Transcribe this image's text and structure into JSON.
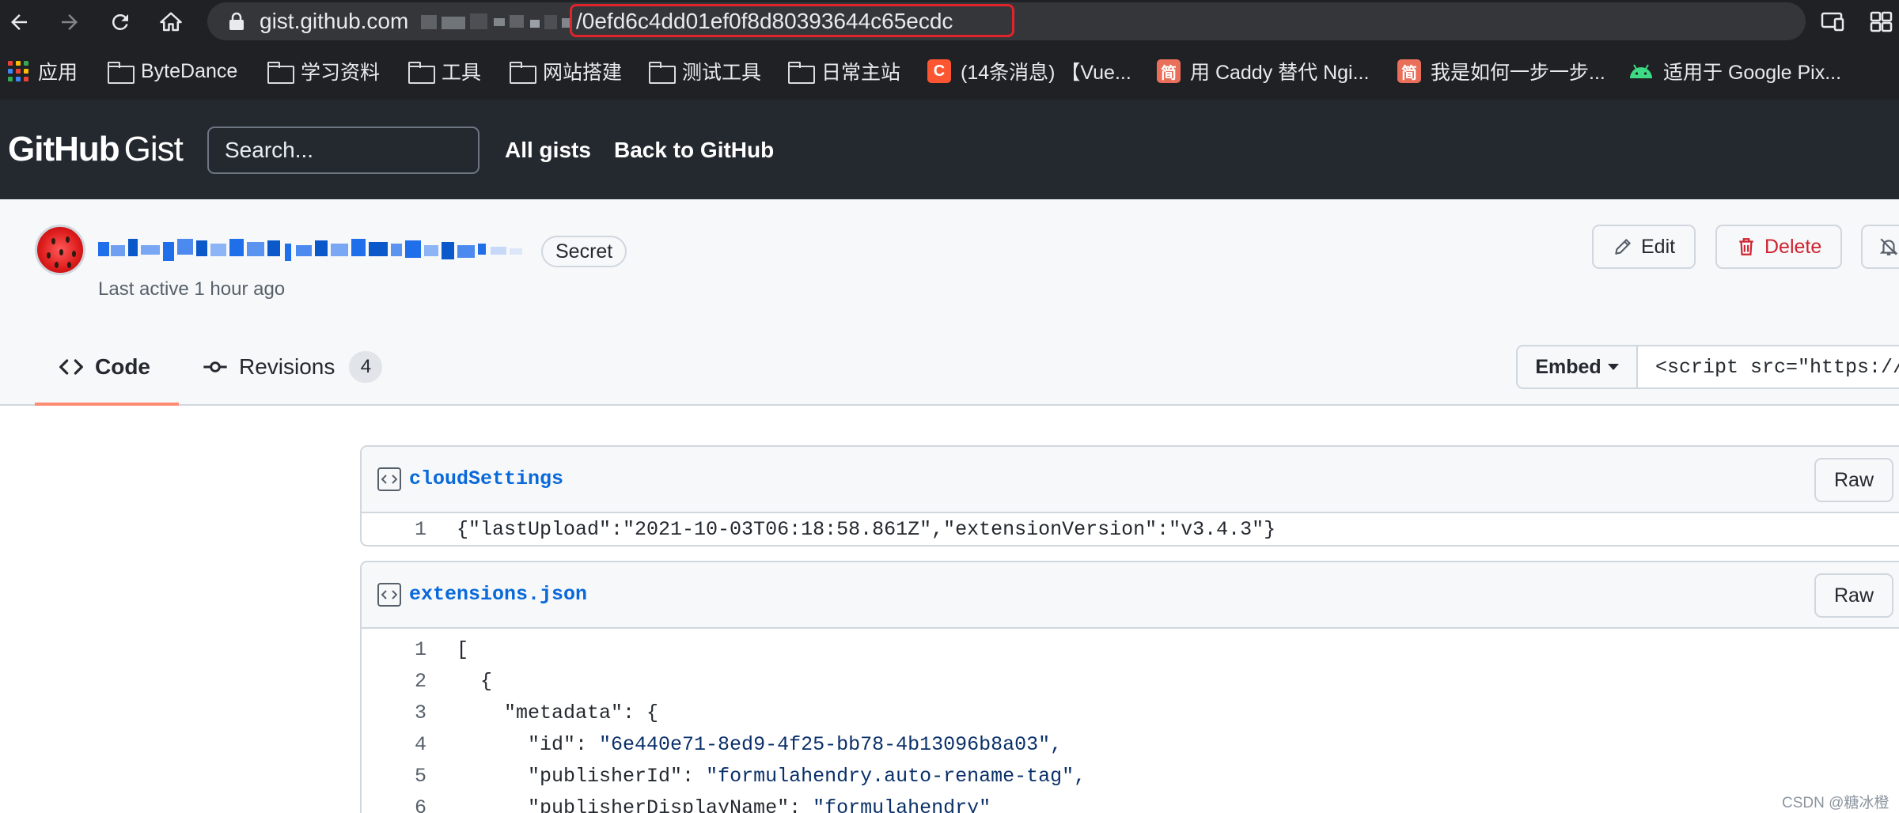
{
  "browser": {
    "url_host": "gist.github.com",
    "url_path_suffix": "/0efd6c4dd01ef0f8d80393644c65ecdc",
    "bookmarks": [
      {
        "label": "应用",
        "icon": "apps-grid-icon"
      },
      {
        "label": "ByteDance",
        "icon": "folder-icon"
      },
      {
        "label": "学习资料",
        "icon": "folder-icon"
      },
      {
        "label": "工具",
        "icon": "folder-icon"
      },
      {
        "label": "网站搭建",
        "icon": "folder-icon"
      },
      {
        "label": "测试工具",
        "icon": "folder-icon"
      },
      {
        "label": "日常主站",
        "icon": "folder-icon"
      },
      {
        "label": "(14条消息) 【Vue...",
        "icon": "csdn-icon",
        "icon_text": "C",
        "color": "#fc5531"
      },
      {
        "label": "用 Caddy 替代 Ngi...",
        "icon": "jianshu-icon",
        "icon_text": "简",
        "color": "#ea6f5a"
      },
      {
        "label": "我是如何一步一步...",
        "icon": "jianshu-icon",
        "icon_text": "简",
        "color": "#ea6f5a"
      },
      {
        "label": "适用于 Google Pix...",
        "icon": "android-icon",
        "color": "#3ddc84"
      }
    ],
    "apps_grid_colors": [
      "#ea4335",
      "#fbbc05",
      "#34a853",
      "#4285f4",
      "#ea4335",
      "#fbbc05",
      "#34a853",
      "#4285f4",
      "#ea4335"
    ]
  },
  "header": {
    "logo_primary": "GitHub",
    "logo_secondary": "Gist",
    "search_placeholder": "Search...",
    "links": [
      "All gists",
      "Back to GitHub"
    ]
  },
  "gist": {
    "visibility_badge": "Secret",
    "last_active": "Last active 1 hour ago",
    "actions": {
      "edit": "Edit",
      "delete": "Delete"
    },
    "tabs": {
      "code": "Code",
      "revisions": "Revisions",
      "revisions_count": "4"
    },
    "embed_label": "Embed",
    "embed_value": "<script src=\"https://"
  },
  "files": [
    {
      "name": "cloudSettings",
      "raw_label": "Raw",
      "lines": [
        {
          "n": "1",
          "text": "{\"lastUpload\":\"2021-10-03T06:18:58.861Z\",\"extensionVersion\":\"v3.4.3\"}"
        }
      ]
    },
    {
      "name": "extensions.json",
      "raw_label": "Raw",
      "lines": [
        {
          "n": "1",
          "text": "["
        },
        {
          "n": "2",
          "text": "  {"
        },
        {
          "n": "3",
          "text": "    \"metadata\": {"
        },
        {
          "n": "4",
          "key": "      \"id\": ",
          "val": "\"6e440e71-8ed9-4f25-bb78-4b13096b8a03\",",
          "text": "      \"id\": \"6e440e71-8ed9-4f25-bb78-4b13096b8a03\","
        },
        {
          "n": "5",
          "key": "      \"publisherId\": ",
          "val": "\"formulahendry.auto-rename-tag\",",
          "text": "      \"publisherId\": \"formulahendry.auto-rename-tag\","
        },
        {
          "n": "6",
          "key": "      \"publisherDisplayName\": ",
          "val": "\"formulahendry\"",
          "text": "      \"publisherDisplayName\": \"formulahendry\""
        }
      ]
    }
  ],
  "watermark": "CSDN @糖冰橙",
  "colors": {
    "header_bg": "#24292f",
    "link_blue": "#0969da",
    "danger": "#cf222e",
    "tab_underline": "#fd8c73",
    "url_highlight": "#e0242a"
  }
}
